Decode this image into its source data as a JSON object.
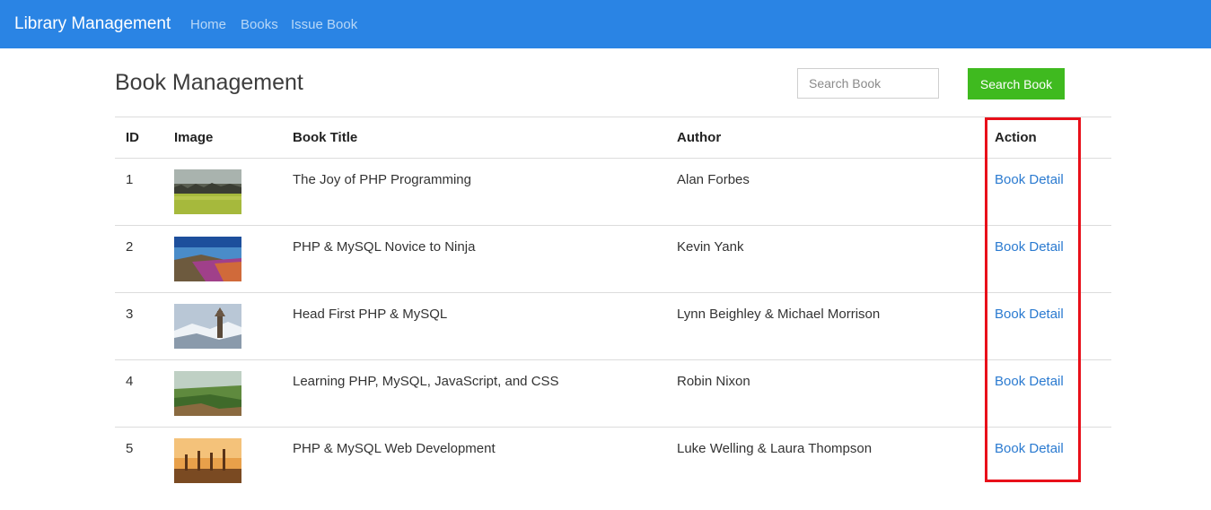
{
  "navbar": {
    "brand": "Library Management",
    "links": [
      "Home",
      "Books",
      "Issue Book"
    ]
  },
  "page": {
    "title": "Book Management",
    "search_placeholder": "Search Book",
    "search_button": "Search Book"
  },
  "table": {
    "headers": [
      "ID",
      "Image",
      "Book Title",
      "Author",
      "Action"
    ],
    "rows": [
      {
        "id": "1",
        "title": "The Joy of PHP Programming",
        "author": "Alan Forbes",
        "action": "Book Detail",
        "image": "zebra-herd-savanna"
      },
      {
        "id": "2",
        "title": "PHP & MySQL Novice to Ninja",
        "author": "Kevin Yank",
        "action": "Book Detail",
        "image": "wildflower-hill-landscape"
      },
      {
        "id": "3",
        "title": "Head First PHP & MySQL",
        "author": "Lynn Beighley & Michael Morrison",
        "action": "Book Detail",
        "image": "snowy-temple-tower"
      },
      {
        "id": "4",
        "title": "Learning PHP, MySQL, JavaScript, and CSS",
        "author": "Robin Nixon",
        "action": "Book Detail",
        "image": "green-valley-forest"
      },
      {
        "id": "5",
        "title": "PHP & MySQL Web Development",
        "author": "Luke Welling & Laura Thompson",
        "action": "Book Detail",
        "image": "sunset-giraffes"
      }
    ]
  },
  "colors": {
    "navbar": "#2a84e4",
    "search_button": "#3fba1f",
    "link": "#2a7ad0",
    "highlight": "#e8101a"
  }
}
